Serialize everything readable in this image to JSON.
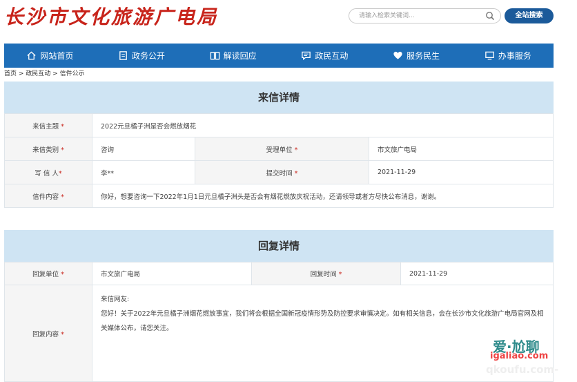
{
  "header": {
    "logo_text": "长沙市文化旅游广电局",
    "search_placeholder": "请输入检索关键词...",
    "search_button": "全站搜索"
  },
  "nav": [
    {
      "label": "网站首页",
      "icon": "home-icon"
    },
    {
      "label": "政务公开",
      "icon": "document-icon"
    },
    {
      "label": "解读回应",
      "icon": "book-icon"
    },
    {
      "label": "政民互动",
      "icon": "chat-icon"
    },
    {
      "label": "服务民生",
      "icon": "heart-hand-icon"
    },
    {
      "label": "办事服务",
      "icon": "computer-icon"
    }
  ],
  "breadcrumb": "首页 > 政民互动 > 信件公示",
  "letter": {
    "title": "来信详情",
    "subject_label": "来信主题",
    "subject": "2022元旦橘子洲是否会燃放烟花",
    "category_label": "来信类别",
    "category": "咨询",
    "handler_label": "受理单位",
    "handler": "市文旅广电局",
    "writer_label": "写 信 人",
    "writer": "李**",
    "submit_time_label": "提交时间",
    "submit_time": "2021-11-29",
    "content_label": "信件内容",
    "content": "你好，想要咨询一下2022年1月1日元旦橘子洲头是否会有烟花燃放庆祝活动，还请领导或者方尽快公布消息，谢谢。",
    "required_mark": "*"
  },
  "reply": {
    "title": "回复详情",
    "unit_label": "回复单位",
    "unit": "市文旅广电局",
    "time_label": "回复时间",
    "time": "2021-11-29",
    "content_label": "回复内容",
    "greeting": "来信网友:",
    "body": "您好！关于2022年元旦橘子洲烟花燃放事宜，我们将会根据全国新冠疫情形势及防控要求审慎决定。如有相关信息，会在长沙市文化旅游广电局官网及相关媒体公布，请您关注。"
  },
  "watermark": {
    "brand": "爱·尬聊",
    "url": "igaliao.com",
    "url2": "qkoufu.com-"
  }
}
